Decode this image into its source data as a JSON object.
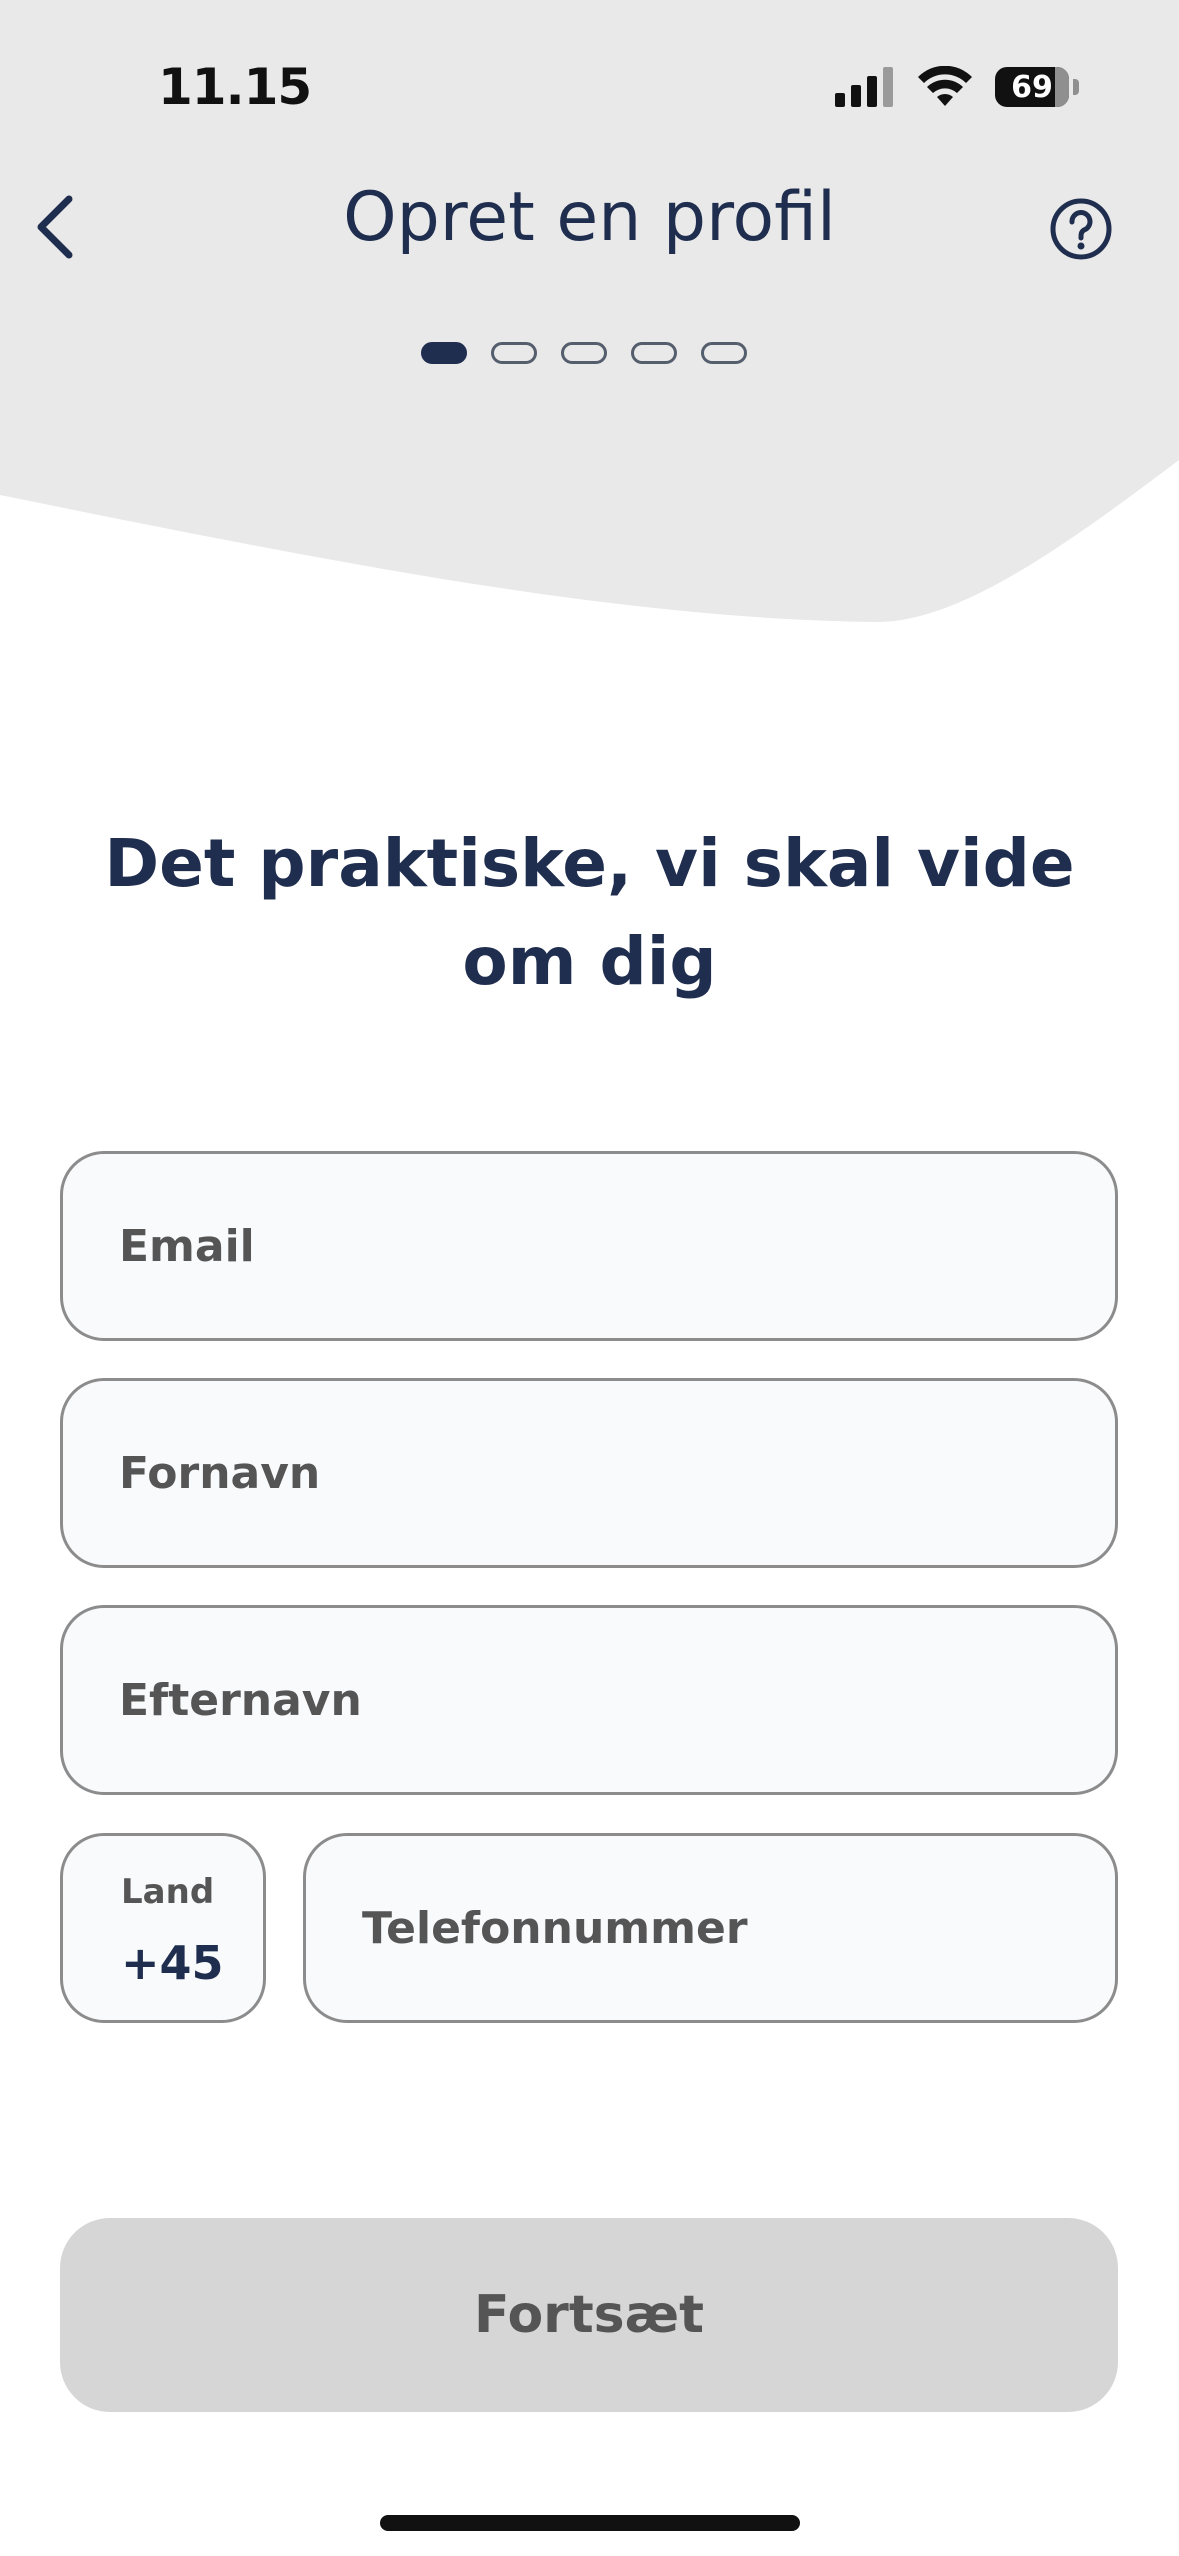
{
  "status_bar": {
    "time": "11.15",
    "battery": "69"
  },
  "header": {
    "title": "Opret en profil",
    "back_icon": "chevron-left-icon",
    "help_icon": "question-circle-icon",
    "steps": {
      "total": 5,
      "current": 1
    }
  },
  "form": {
    "heading": "Det praktiske, vi skal vide om dig",
    "email_placeholder": "Email",
    "first_name_placeholder": "Fornavn",
    "last_name_placeholder": "Efternavn",
    "country_label": "Land",
    "country_code": "+45",
    "phone_placeholder": "Telefonnummer"
  },
  "actions": {
    "continue_label": "Fortsæt"
  },
  "colors": {
    "primary": "#1f2d4e",
    "header_bg": "#e9e9e9",
    "field_border": "#8c8c8c",
    "field_bg": "#f9fafc",
    "button_disabled": "#d6d6d6"
  }
}
